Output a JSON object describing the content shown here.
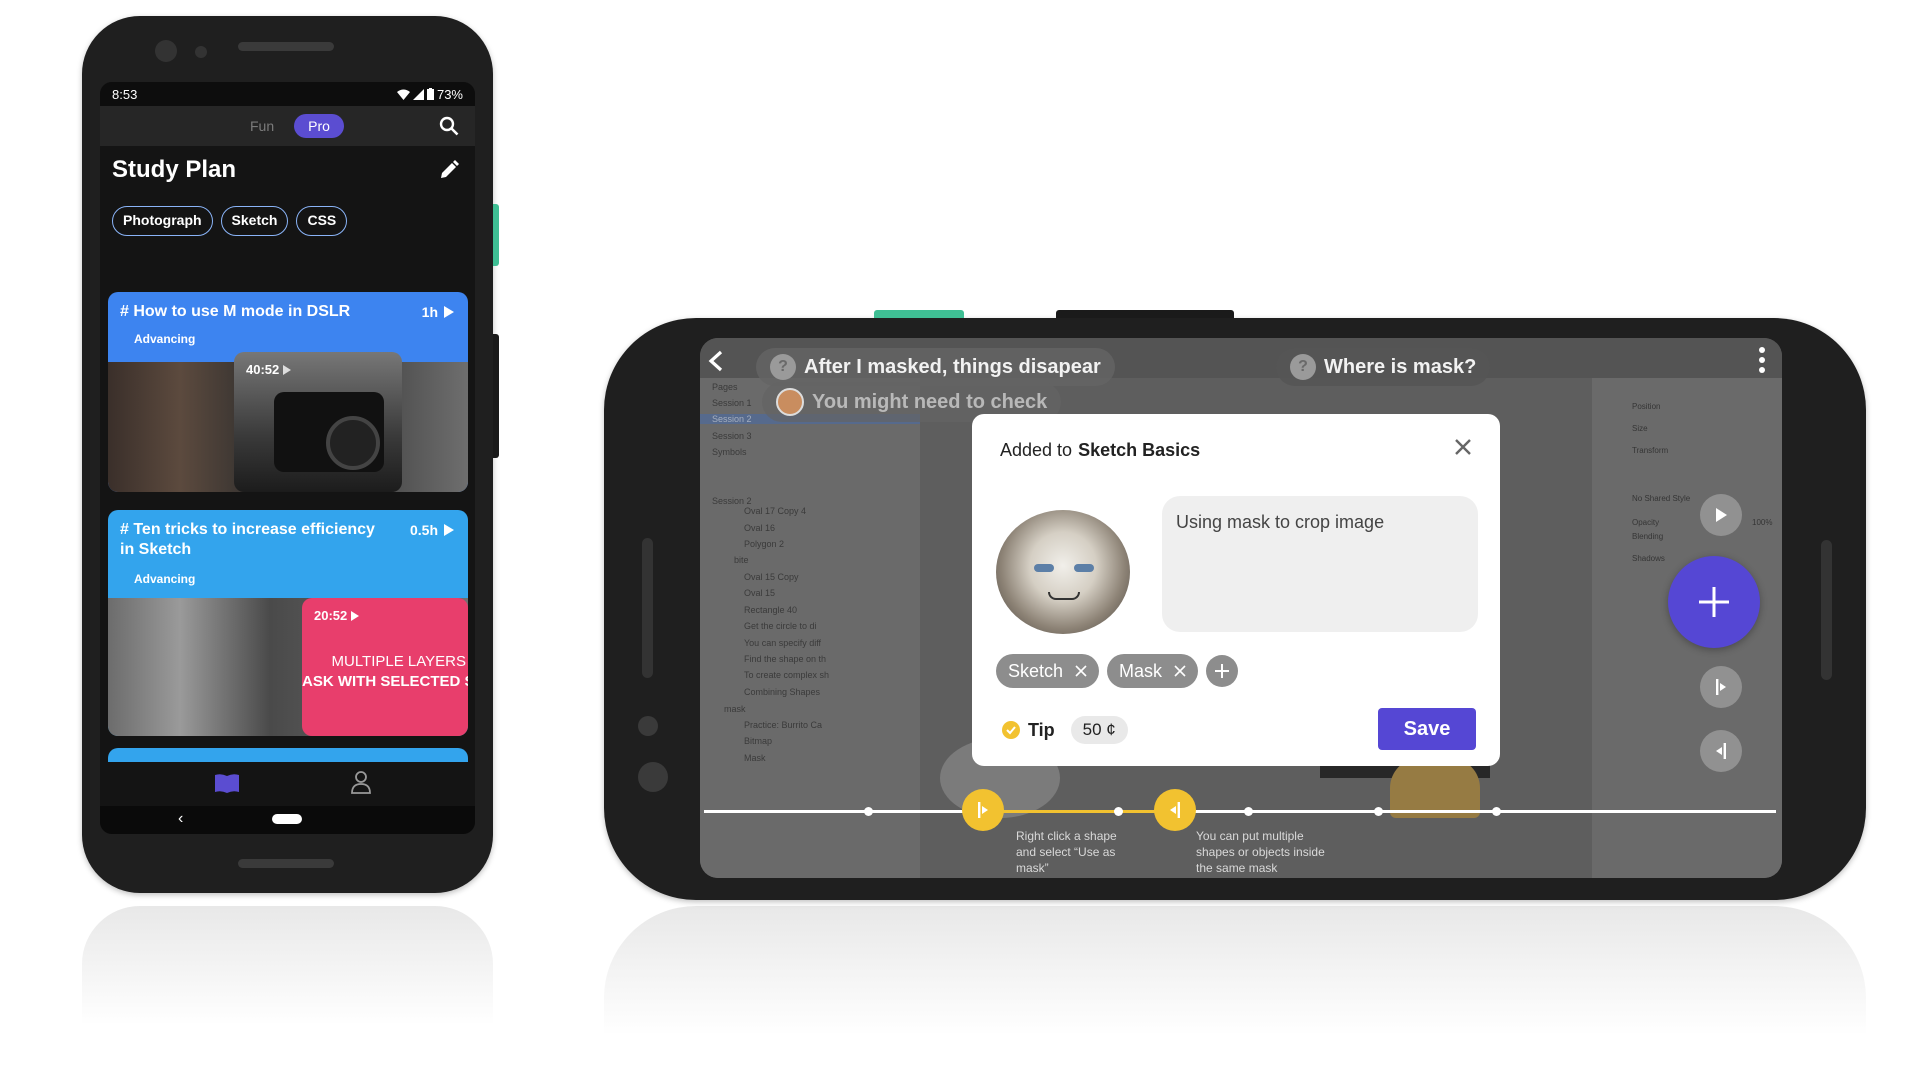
{
  "portrait": {
    "status": {
      "time": "8:53",
      "battery": "73%"
    },
    "segment": {
      "fun_label": "Fun",
      "pro_label": "Pro"
    },
    "title": "Study Plan",
    "chips": [
      "Photograph",
      "Sketch",
      "CSS"
    ],
    "courses": [
      {
        "title": "# How to use M mode in DSLR",
        "duration": "1h",
        "level": "Advancing",
        "thumb_time": "40:52",
        "accent": "#3d84f0"
      },
      {
        "title": "# Ten tricks to increase efficiency in Sketch",
        "duration": "0.5h",
        "level": "Advancing",
        "thumb_time": "20:52",
        "thumb_text_1": "MULTIPLE LAYERS",
        "thumb_text_2": "ASK WITH SELECTED S",
        "accent": "#33a4ed"
      }
    ]
  },
  "landscape": {
    "bubbles": {
      "q1": "After I masked, things disapear",
      "q2": "Where is mask?",
      "reply": "You might need to check"
    },
    "sketch_sidebar": {
      "pages_label": "Pages",
      "pages": [
        "Session 1",
        "Session 2",
        "Session 3",
        "Symbols"
      ],
      "layers_label": "Session 2",
      "layers": [
        "Oval 17 Copy 4",
        "Oval 16",
        "Polygon 2",
        "bite",
        "Oval 15 Copy",
        "Oval 15",
        "Rectangle 40",
        "Get the circle to di",
        "You can specify diff",
        "Find the shape on th",
        "To create complex sh",
        "Combining Shapes",
        "mask",
        "Practice: Burrito Ca",
        "Bitmap",
        "Mask"
      ]
    },
    "inspector": {
      "position_label": "Position",
      "size_label": "Size",
      "transform_label": "Transform",
      "opacity_label": "Opacity",
      "blending_label": "Blending",
      "shadows_label": "Shadows",
      "style_label": "No Shared Style",
      "opacity_value": "100%"
    },
    "dialog": {
      "added_prefix": "Added to",
      "collection": "Sketch Basics",
      "note": "Using mask to crop image",
      "tags": [
        "Sketch",
        "Mask"
      ],
      "tip_label": "Tip",
      "tip_amount": "50 ¢",
      "save_label": "Save"
    },
    "captions": [
      "Right click a shape and select “Use as mask”",
      "You can put multiple shapes or objects inside the same mask"
    ]
  },
  "colors": {
    "accent_purple": "#5547d4",
    "pro_pill": "#5b4dd1",
    "timeline_yellow": "#f2c230",
    "card_blue": "#3d84f0",
    "card_cyan": "#33a4ed"
  }
}
